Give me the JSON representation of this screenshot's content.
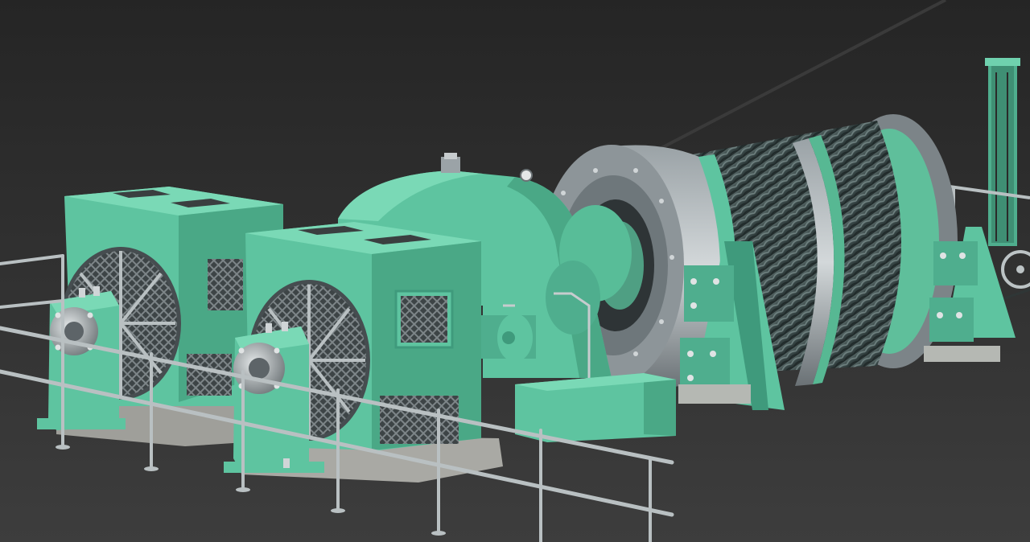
{
  "scene": {
    "subject": "mine-hoist-3d-render",
    "colors": {
      "background_top": "#262626",
      "background_bottom": "#3e3e3e",
      "machine_green": "#5ec4a0",
      "machine_green_dark": "#3f9a7c",
      "machine_green_light": "#7ad9b6",
      "steel": "#a8b0b4",
      "steel_dark": "#5d6468",
      "rope": "#3b4a4c",
      "rope_light": "#60706f",
      "railing": "#b9c0c2",
      "base_concrete": "#a9a9a4"
    }
  }
}
